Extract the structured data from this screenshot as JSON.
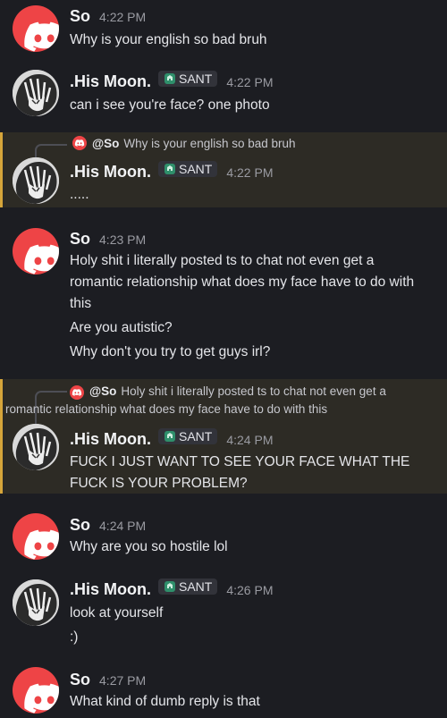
{
  "messages": [
    {
      "author": "So",
      "time": "4:22 PM",
      "lines": [
        "Why is your english so bad bruh"
      ]
    },
    {
      "author": ".His Moon.",
      "tag": "SANT",
      "time": "4:22 PM",
      "lines": [
        "can i see you're face? one photo"
      ]
    },
    {
      "author": ".His Moon.",
      "tag": "SANT",
      "time": "4:22 PM",
      "reply_mention": "@So",
      "reply_text": "Why is your english so bad bruh",
      "lines": [
        "....."
      ]
    },
    {
      "author": "So",
      "time": "4:23 PM",
      "lines": [
        "Holy shit i literally posted ts to chat not even get a",
        "romantic relationship what does my face have to do with",
        "this",
        "Are you autistic?",
        "Why don't you try to get guys irl?"
      ]
    },
    {
      "author": ".His Moon.",
      "tag": "SANT",
      "time": "4:24 PM",
      "reply_mention": "@So",
      "reply_text_1": "Holy shit i literally posted ts to chat not even get a",
      "reply_text_2": "romantic relationship what does my face have to do with this",
      "lines": [
        "FUCK I JUST WANT TO SEE YOUR FACE WHAT THE",
        "FUCK IS YOUR PROBLEM?"
      ]
    },
    {
      "author": "So",
      "time": "4:24 PM",
      "lines": [
        "Why are you so hostile lol"
      ]
    },
    {
      "author": ".His Moon.",
      "tag": "SANT",
      "time": "4:26 PM",
      "lines": [
        "look at yourself",
        ":)"
      ]
    },
    {
      "author": "So",
      "time": "4:27 PM",
      "lines": [
        "What kind of dumb reply is that"
      ]
    }
  ],
  "colors": {
    "discord_red": "#ee4446",
    "highlight_bar": "#d6a53a",
    "background": "#1c1d22"
  },
  "icons": {
    "discord_avatar": "discord-logo-icon",
    "moon_avatar": "anime-character-avatar",
    "tag_icon": "clan-tag-icon"
  }
}
